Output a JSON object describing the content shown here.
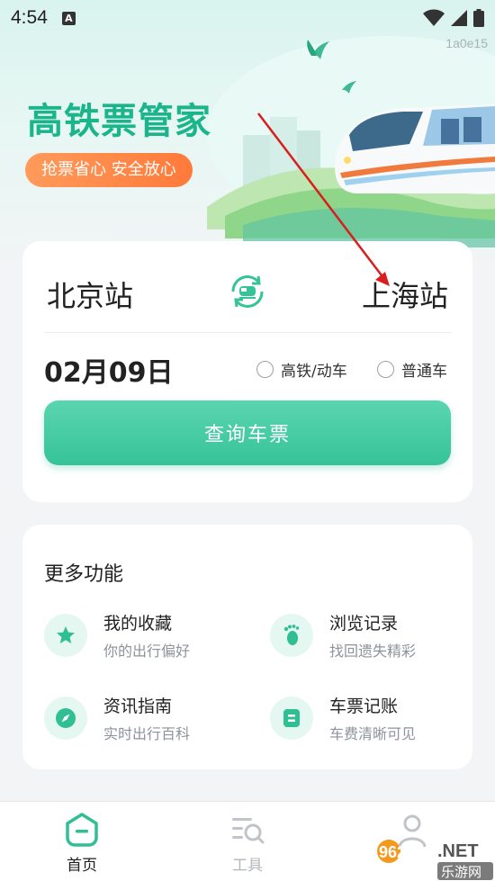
{
  "status_bar": {
    "time": "4:54",
    "notification_badge": "A"
  },
  "build_id": "1a0e15",
  "hero": {
    "title": "高铁票管家",
    "slogan": "抢票省心 安全放心"
  },
  "search": {
    "from_station": "北京站",
    "to_station": "上海站",
    "date": "02月09日",
    "train_types": [
      {
        "label": "高铁/动车",
        "selected": false
      },
      {
        "label": "普通车",
        "selected": false
      }
    ],
    "search_button": "查询车票"
  },
  "more": {
    "title": "更多功能",
    "features": [
      {
        "name": "我的收藏",
        "desc": "你的出行偏好",
        "icon": "star-icon"
      },
      {
        "name": "浏览记录",
        "desc": "找回遗失精彩",
        "icon": "footprint-icon"
      },
      {
        "name": "资讯指南",
        "desc": "实时出行百科",
        "icon": "compass-icon"
      },
      {
        "name": "车票记账",
        "desc": "车费清晰可见",
        "icon": "ledger-icon"
      }
    ]
  },
  "bottom_nav": [
    {
      "label": "首页",
      "active": true,
      "icon": "home-icon"
    },
    {
      "label": "工具",
      "active": false,
      "icon": "tools-icon"
    },
    {
      "label": "我的",
      "active": false,
      "icon": "profile-icon"
    }
  ],
  "watermark": {
    "text_main": "962",
    "text_net": ".NET",
    "text_cn": "乐游网"
  },
  "colors": {
    "brand_green": "#1bb58c",
    "button_green": "#3cc79b",
    "slogan_orange": "#ff8a48",
    "annotation_red": "#d81e1e"
  }
}
